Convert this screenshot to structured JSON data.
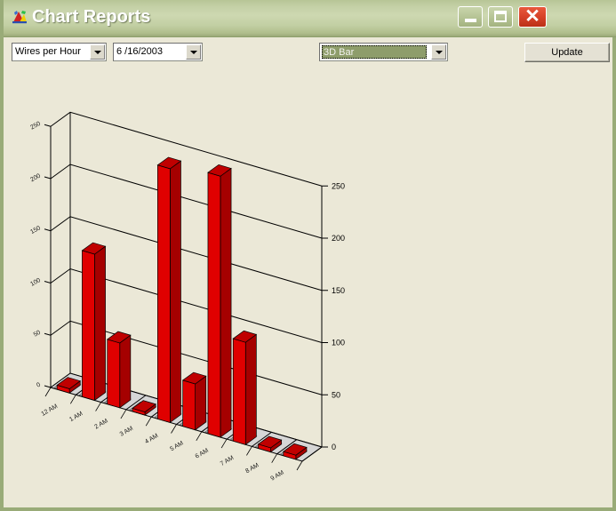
{
  "window": {
    "title": "Chart Reports",
    "icon": "chart-app-icon",
    "background_color": "#EBE8D7",
    "titlebar_color": "#C4D0A6",
    "border_color": "#99AB78",
    "buttons": {
      "minimize": "minimize-button",
      "maximize": "maximize-button",
      "close_glyph": "✕"
    }
  },
  "toolbar": {
    "report_select": {
      "value": "Wires per Hour",
      "options": [
        "Wires per Hour"
      ]
    },
    "date_select": {
      "value": "6 /16/2003",
      "options": [
        "6 /16/2003"
      ]
    },
    "chart_type_select": {
      "value": "3D Bar",
      "options": [
        "3D Bar"
      ],
      "focused": true,
      "highlight_color": "#8E9D6B"
    },
    "update_button": {
      "label": "Update"
    }
  },
  "chart_data": {
    "type": "bar",
    "title": "",
    "subtitle": "",
    "xlabel": "",
    "ylabel": "",
    "style": "3D Bar",
    "bar_color": "#E00000",
    "bar_side_color": "#A50000",
    "bar_top_color": "#C00000",
    "plot_background": "#EBE8D7",
    "grid": true,
    "legend": "none",
    "ylim": [
      0,
      250
    ],
    "yticks": [
      "0",
      "50",
      "100",
      "150",
      "200",
      "250"
    ],
    "ytick_values": [
      0,
      50,
      100,
      150,
      200,
      250
    ],
    "right_axis_labels": [
      "250",
      "200",
      "150",
      "100",
      "50",
      "0"
    ],
    "left_axis_labels": [
      "250",
      "200",
      "150",
      "100",
      "50",
      "0"
    ],
    "categories": [
      "12 AM",
      "1 AM",
      "2 AM",
      "3 AM",
      "4 AM",
      "5 AM",
      "6 AM",
      "7 AM",
      "8 AM",
      "9 AM"
    ],
    "values": [
      4,
      140,
      62,
      3,
      243,
      44,
      250,
      98,
      4,
      4
    ]
  }
}
